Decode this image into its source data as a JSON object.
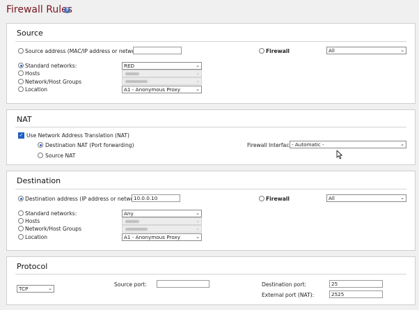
{
  "page": {
    "title": "Firewall Rules",
    "help_icon": "?"
  },
  "source": {
    "title": "Source",
    "address_label": "Source address (MAC/IP address or network):",
    "address_value": "",
    "firewall_label": "Firewall",
    "firewall_value": "All",
    "standard_networks_label": "Standard networks:",
    "standard_networks_value": "RED",
    "hosts_label": "Hosts",
    "groups_label": "Network/Host Groups",
    "location_label": "Location",
    "location_value": "A1 - Anonymous Proxy"
  },
  "nat": {
    "title": "NAT",
    "use_nat_label": "Use Network Address Translation (NAT)",
    "destination_nat_label": "Destination NAT (Port forwarding)",
    "source_nat_label": "Source NAT",
    "interface_label": "Firewall Interface:",
    "interface_value": "- Automatic -"
  },
  "destination": {
    "title": "Destination",
    "address_label": "Destination address (IP address or network):",
    "address_value": "10.0.0.10",
    "firewall_label": "Firewall",
    "firewall_value": "All",
    "standard_networks_label": "Standard networks:",
    "standard_networks_value": "Any",
    "hosts_label": "Hosts",
    "groups_label": "Network/Host Groups",
    "location_label": "Location",
    "location_value": "A1 - Anonymous Proxy"
  },
  "protocol": {
    "title": "Protocol",
    "protocol_value": "TCP",
    "source_port_label": "Source port:",
    "source_port_value": "",
    "destination_port_label": "Destination port:",
    "destination_port_value": "25",
    "external_port_label": "External port (NAT):",
    "external_port_value": "2525"
  }
}
